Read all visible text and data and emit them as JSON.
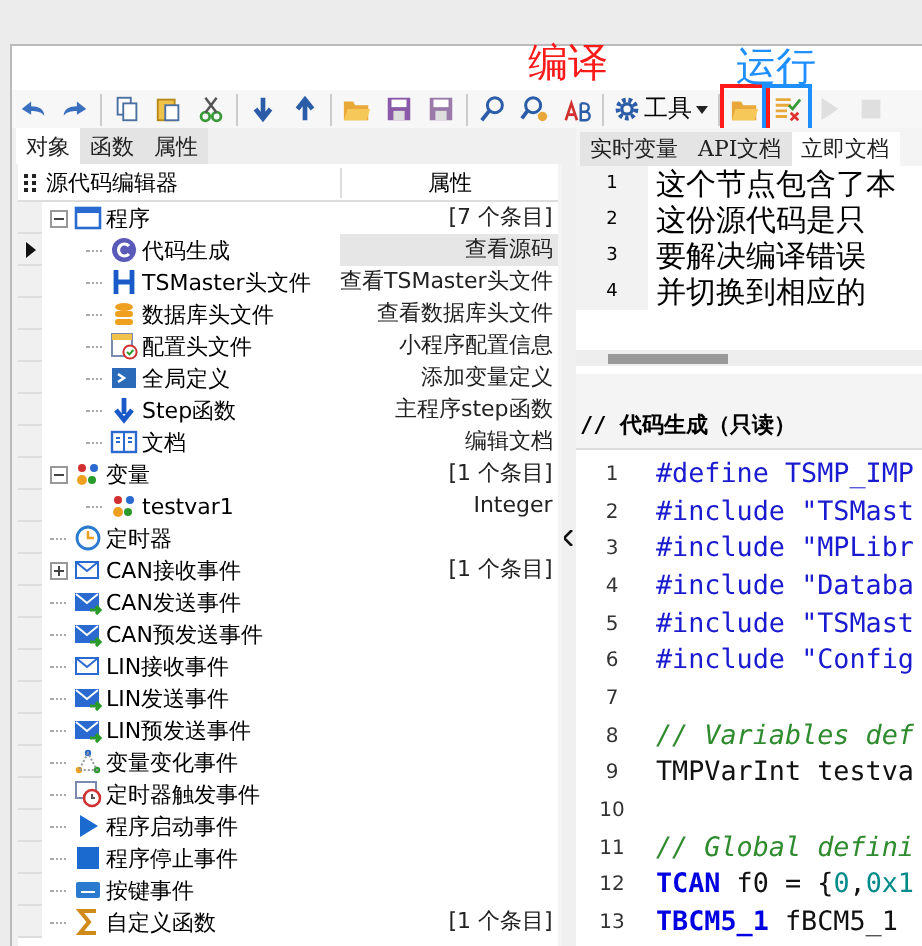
{
  "annotations": [
    {
      "text": "编译",
      "color": "#ff1a1a"
    },
    {
      "text": "运行",
      "color": "#1e8fff"
    }
  ],
  "toolbar": [
    {
      "kind": "button",
      "disabled": false
    },
    {
      "kind": "button",
      "disabled": false
    },
    {
      "kind": "separator"
    },
    {
      "kind": "button",
      "disabled": false
    },
    {
      "kind": "button",
      "disabled": false
    },
    {
      "kind": "button",
      "disabled": false
    },
    {
      "kind": "separator"
    },
    {
      "kind": "button",
      "disabled": false
    },
    {
      "kind": "button",
      "disabled": false
    },
    {
      "kind": "separator"
    },
    {
      "kind": "button",
      "disabled": false
    },
    {
      "kind": "button",
      "disabled": false
    },
    {
      "kind": "button",
      "disabled": false
    },
    {
      "kind": "separator"
    },
    {
      "kind": "button",
      "disabled": false
    },
    {
      "kind": "button",
      "disabled": false
    },
    {
      "kind": "button",
      "disabled": false
    },
    {
      "kind": "separator"
    },
    {
      "kind": "menu",
      "label": "工具"
    },
    {
      "kind": "separator"
    },
    {
      "kind": "button",
      "disabled": false,
      "annotated": true
    },
    {
      "kind": "button",
      "disabled": false,
      "annotated": true
    },
    {
      "kind": "button",
      "disabled": true
    },
    {
      "kind": "button",
      "disabled": true
    }
  ],
  "left_tabs": [
    {
      "label": "对象",
      "selected": true
    },
    {
      "label": "函数",
      "selected": false
    },
    {
      "label": "属性",
      "selected": false
    }
  ],
  "tree": {
    "columns": [
      "源代码编辑器",
      "属性"
    ],
    "items": [
      {
        "label": "程序",
        "value": "[7 个条目]",
        "selected": false,
        "expanded": true,
        "children": [
          {
            "label": "代码生成",
            "value": "查看源码",
            "selected": true
          },
          {
            "label": "TSMaster头文件",
            "value": "查看TSMaster头文件",
            "selected": false
          },
          {
            "label": "数据库头文件",
            "value": "查看数据库头文件",
            "selected": false
          },
          {
            "label": "配置头文件",
            "value": "小程序配置信息",
            "selected": false
          },
          {
            "label": "全局定义",
            "value": "添加变量定义",
            "selected": false
          },
          {
            "label": "Step函数",
            "value": "主程序step函数",
            "selected": false
          },
          {
            "label": "文档",
            "value": "编辑文档",
            "selected": false
          }
        ]
      },
      {
        "label": "变量",
        "value": "[1 个条目]",
        "selected": false,
        "expanded": true,
        "children": [
          {
            "label": "testvar1",
            "value": "Integer",
            "selected": false
          }
        ]
      },
      {
        "label": "定时器",
        "selected": false
      },
      {
        "label": "CAN接收事件",
        "value": "[1 个条目]",
        "selected": false,
        "expanded": false
      },
      {
        "label": "CAN发送事件",
        "selected": false
      },
      {
        "label": "CAN预发送事件",
        "selected": false
      },
      {
        "label": "LIN接收事件",
        "selected": false
      },
      {
        "label": "LIN发送事件",
        "selected": false
      },
      {
        "label": "LIN预发送事件",
        "selected": false
      },
      {
        "label": "变量变化事件",
        "selected": false
      },
      {
        "label": "定时器触发事件",
        "selected": false
      },
      {
        "label": "程序启动事件",
        "selected": false
      },
      {
        "label": "程序停止事件",
        "selected": false
      },
      {
        "label": "按键事件",
        "selected": false
      },
      {
        "label": "自定义函数",
        "value": "[1 个条目]",
        "selected": false
      }
    ]
  },
  "right_tabs": [
    {
      "label": "实时变量",
      "selected": false
    },
    {
      "label": "API文档",
      "selected": false
    },
    {
      "label": "立即文档",
      "selected": true
    }
  ],
  "doc_lines": [
    {
      "no": "1",
      "text": "这个节点包含了本"
    },
    {
      "no": "2",
      "text": "这份源代码是只"
    },
    {
      "no": "3",
      "text": "要解决编译错误"
    },
    {
      "no": "4",
      "text": "并切换到相应的"
    }
  ],
  "code_title": "// 代码生成（只读）",
  "code_lines": [
    {
      "no": "1",
      "tokens": [
        {
          "kind": "pre",
          "text": "#define TSMP_IMP"
        }
      ]
    },
    {
      "no": "2",
      "tokens": [
        {
          "kind": "pre",
          "text": "#include "
        },
        {
          "kind": "str",
          "text": "\"TSMast"
        }
      ]
    },
    {
      "no": "3",
      "tokens": [
        {
          "kind": "pre",
          "text": "#include "
        },
        {
          "kind": "str",
          "text": "\"MPLibr"
        }
      ]
    },
    {
      "no": "4",
      "tokens": [
        {
          "kind": "pre",
          "text": "#include "
        },
        {
          "kind": "str",
          "text": "\"Databa"
        }
      ]
    },
    {
      "no": "5",
      "tokens": [
        {
          "kind": "pre",
          "text": "#include "
        },
        {
          "kind": "str",
          "text": "\"TSMast"
        }
      ]
    },
    {
      "no": "6",
      "tokens": [
        {
          "kind": "pre",
          "text": "#include "
        },
        {
          "kind": "str",
          "text": "\"Config"
        }
      ]
    },
    {
      "no": "7"
    },
    {
      "no": "8",
      "tokens": [
        {
          "kind": "cmt",
          "text": "// Variables def"
        }
      ]
    },
    {
      "no": "9",
      "tokens": [
        {
          "kind": "txt",
          "text": "TMPVarInt testva"
        }
      ]
    },
    {
      "no": "10"
    },
    {
      "no": "11",
      "tokens": [
        {
          "kind": "cmt",
          "text": "// Global defini"
        }
      ]
    },
    {
      "no": "12",
      "tokens": [
        {
          "kind": "kw",
          "text": "TCAN"
        },
        {
          "kind": "txt",
          "text": " f0 = {"
        },
        {
          "kind": "num",
          "text": "0"
        },
        {
          "kind": "txt",
          "text": ","
        },
        {
          "kind": "num",
          "text": "0x1"
        }
      ]
    },
    {
      "no": "13",
      "tokens": [
        {
          "kind": "kw",
          "text": "TBCM5_1"
        },
        {
          "kind": "txt",
          "text": " fBCM5_1"
        }
      ]
    }
  ]
}
